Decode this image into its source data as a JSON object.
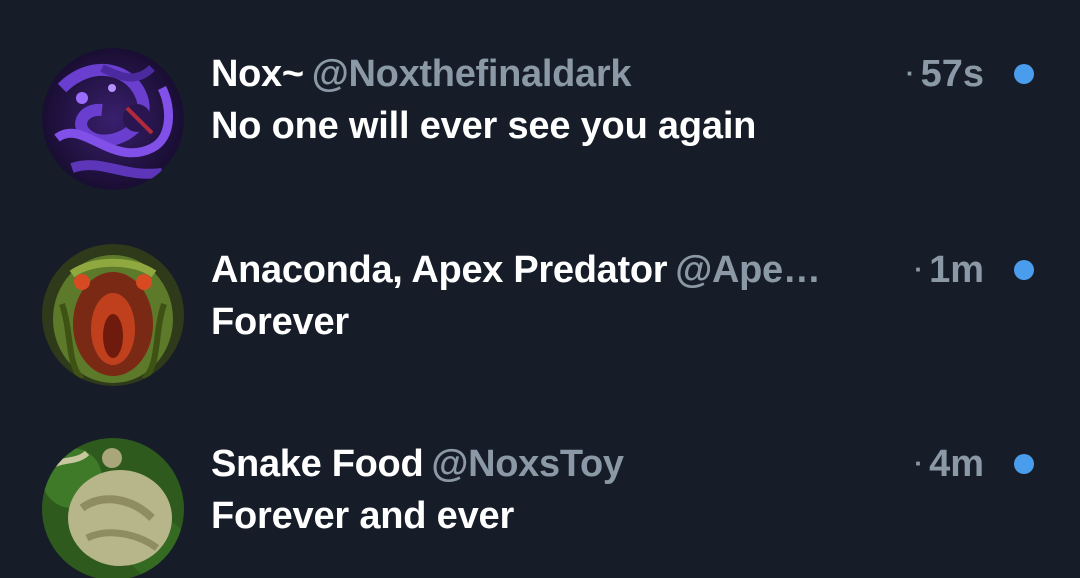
{
  "conversations": [
    {
      "name": "Nox~",
      "handle": "@Noxthefinaldark",
      "time": "57s",
      "message": "No one will ever see you again",
      "unread": true
    },
    {
      "name": "Anaconda, Apex Predator",
      "handle": "@Ape…",
      "time": "1m",
      "message": "Forever",
      "unread": true
    },
    {
      "name": "Snake Food",
      "handle": "@NoxsToy",
      "time": "4m",
      "message": "Forever and ever",
      "unread": true
    }
  ],
  "separator": "·",
  "colors": {
    "background": "#161d28",
    "primary_text": "#ffffff",
    "secondary_text": "#8b98a5",
    "unread_dot": "#4a9cec"
  }
}
